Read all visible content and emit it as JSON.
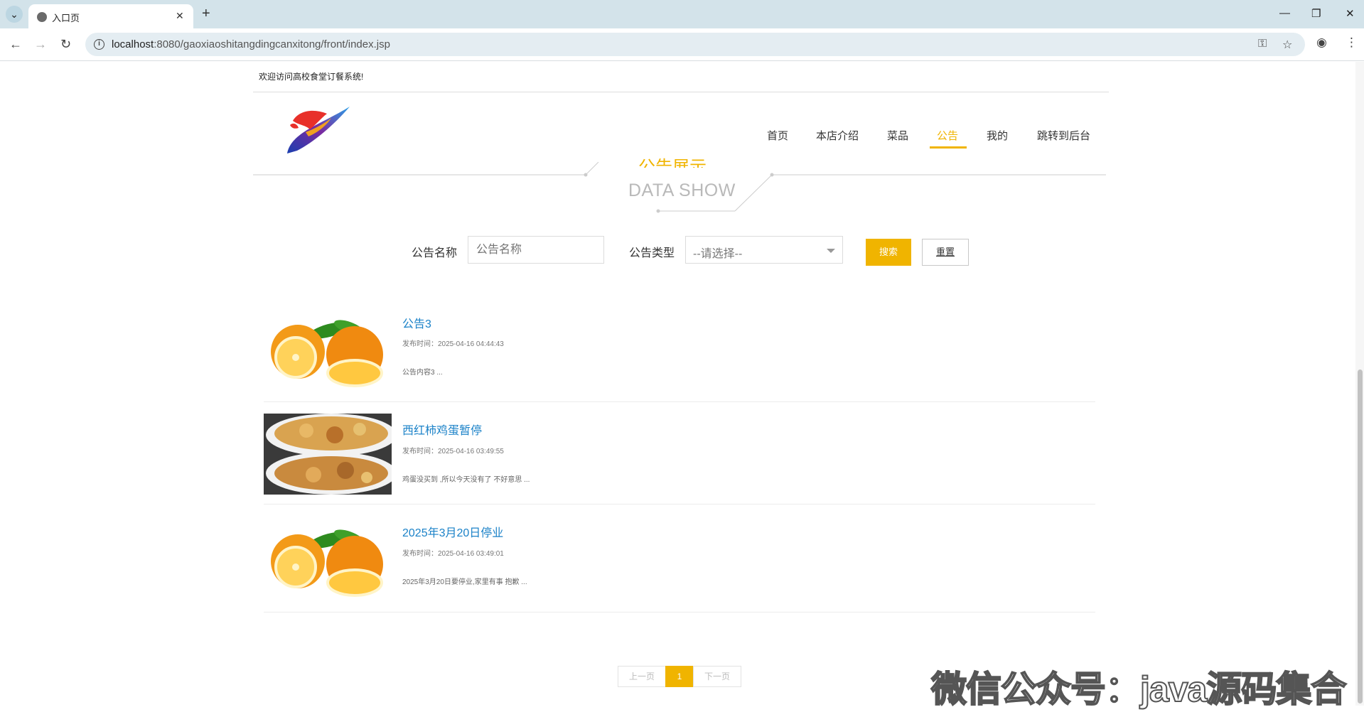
{
  "browser": {
    "tab_title": "入口页",
    "url_host": "localhost",
    "url_rest": ":8080/gaoxiaoshitangdingcanxitong/front/index.jsp"
  },
  "header": {
    "welcome": "欢迎访问高校食堂订餐系统!",
    "nav": [
      "首页",
      "本店介绍",
      "菜品",
      "公告",
      "我的",
      "跳转到后台"
    ],
    "active_nav": "公告"
  },
  "section": {
    "title_cn": "公告展示",
    "title_en": "DATA SHOW"
  },
  "search": {
    "name_label": "公告名称",
    "name_placeholder": "公告名称",
    "type_label": "公告类型",
    "type_selected": "--请选择--",
    "search_button": "搜索",
    "reset_button": "重置"
  },
  "notices": [
    {
      "title": "公告3",
      "time": "发布时间：2025-04-16 04:44:43",
      "content": "公告内容3 ...",
      "image": "orange"
    },
    {
      "title": "西红柿鸡蛋暂停",
      "time": "发布时间：2025-04-16 03:49:55",
      "content": "鸡蛋没买到 ,所以今天没有了 不好意思 ...",
      "image": "food"
    },
    {
      "title": "2025年3月20日停业",
      "time": "发布时间：2025-04-16 03:49:01",
      "content": "2025年3月20日要停业,家里有事 抱歉 ...",
      "image": "orange"
    }
  ],
  "pagination": {
    "prev": "上一页",
    "current": "1",
    "next": "下一页"
  },
  "watermark": "微信公众号：java源码集合",
  "colors": {
    "accent": "#f0b400",
    "link": "#1b82c8"
  }
}
